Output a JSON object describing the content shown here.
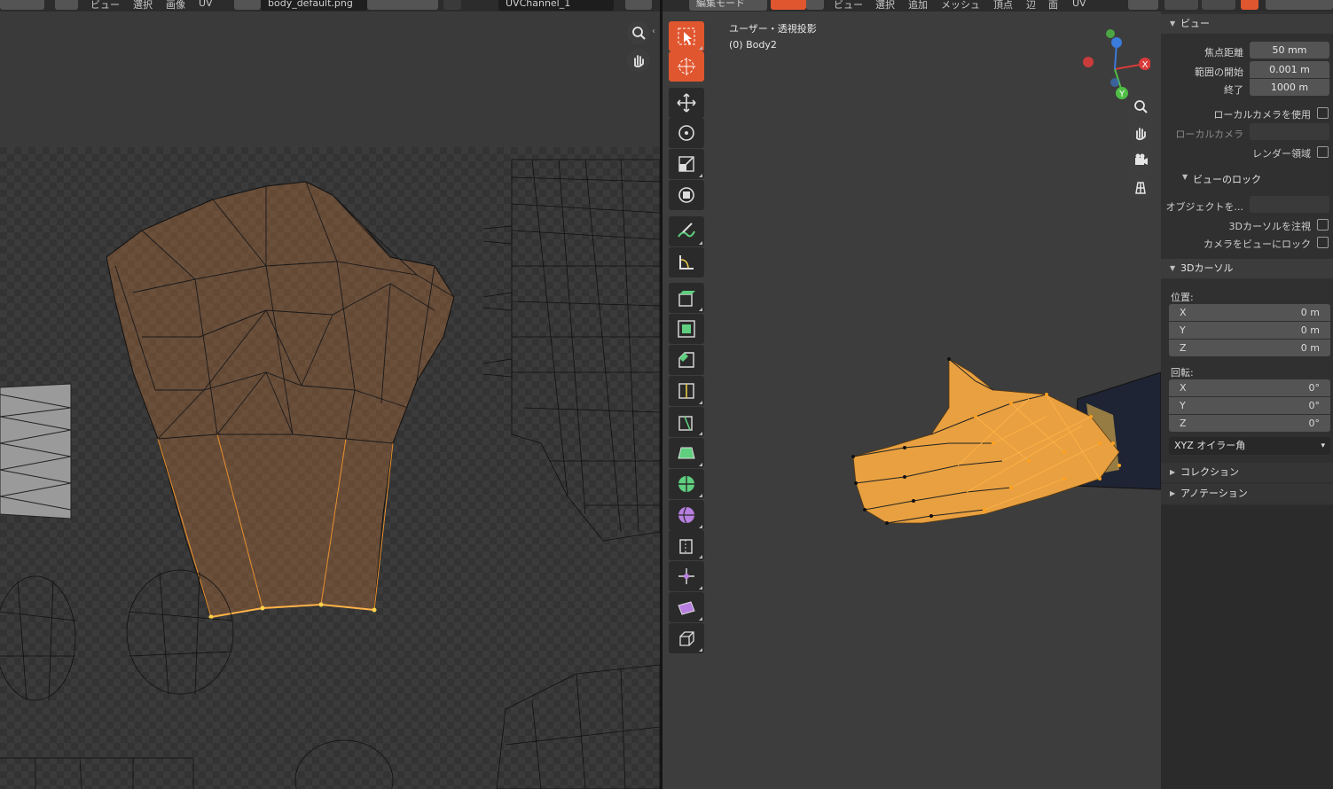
{
  "uv_editor": {
    "header": {
      "menu_view": "ビュー",
      "menu_select": "選択",
      "menu_image": "画像",
      "menu_uv": "UV",
      "image_name": "body_default.png",
      "uv_map": "UVChannel_1"
    },
    "nav": {
      "zoom_icon": "zoom-icon",
      "pan_icon": "hand-icon"
    }
  },
  "viewport": {
    "header": {
      "mode": "編集モード",
      "menu_view": "ビュー",
      "menu_select": "選択",
      "menu_add": "追加",
      "menu_mesh": "メッシュ",
      "menu_vertex": "頂点",
      "menu_edge": "辺",
      "menu_face": "面",
      "menu_uv": "UV"
    },
    "overlay_title": "ユーザー・透視投影",
    "overlay_object": "(0) Body2",
    "gizmo": {
      "x": "X",
      "y": "Y",
      "z": "Z"
    }
  },
  "properties": {
    "view_panel": {
      "title": "ビュー",
      "focal_length_label": "焦点距離",
      "focal_length": "50 mm",
      "clip_start_label": "範囲の開始",
      "clip_start": "0.001 m",
      "clip_end_label": "終了",
      "clip_end": "1000 m",
      "use_local_camera": "ローカルカメラを使用",
      "local_camera": "ローカルカメラ",
      "render_region": "レンダー領域"
    },
    "view_lock": {
      "title": "ビューのロック",
      "lock_object": "オブジェクトを...",
      "lock_cursor": "3Dカーソルを注視",
      "lock_camera": "カメラをビューにロック"
    },
    "cursor_panel": {
      "title": "3Dカーソル",
      "location_label": "位置:",
      "loc": [
        {
          "axis": "X",
          "value": "0 m"
        },
        {
          "axis": "Y",
          "value": "0 m"
        },
        {
          "axis": "Z",
          "value": "0 m"
        }
      ],
      "rotation_label": "回転:",
      "rot": [
        {
          "axis": "X",
          "value": "0°"
        },
        {
          "axis": "Y",
          "value": "0°"
        },
        {
          "axis": "Z",
          "value": "0°"
        }
      ],
      "rotation_mode": "XYZ オイラー角"
    },
    "collection": "コレクション",
    "annotation": "アノテーション"
  },
  "colors": {
    "accent": "#e0562f",
    "selected_mesh": "#e8a040",
    "axis_x": "#d93b3b",
    "axis_y": "#4fbf45",
    "axis_z": "#3b7bd9"
  }
}
